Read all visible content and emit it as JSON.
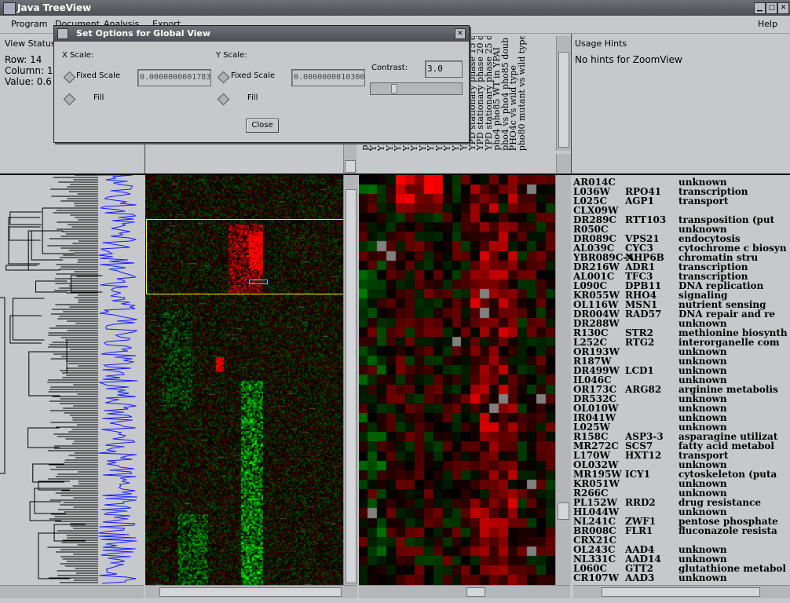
{
  "window": {
    "title": "Java TreeView",
    "buttons": {
      "minimize": "▁",
      "maximize": "□",
      "close": "✕"
    }
  },
  "menu": {
    "items": [
      "Program",
      "Document",
      "Analysis",
      "Export",
      "Help"
    ]
  },
  "status": {
    "title": "View Status",
    "row": "Row:  14",
    "column": "Column: 1",
    "value": "Value: 0.6"
  },
  "hints": {
    "title": "Usage Hints",
    "text": "No hints for ZoomView"
  },
  "dialog": {
    "title": "Set Options for Global View",
    "x_scale_label": "X Scale:",
    "y_scale_label": "Y Scale:",
    "fixed_scale": "Fixed Scale",
    "fill": "Fill",
    "x_value": "0.0000000001783",
    "y_value": "0.0000000010300",
    "contrast_label": "Contrast:",
    "contrast_value": "3.0",
    "close": "Close"
  },
  "arrays": [
    "pa",
    "YPD",
    "YPD",
    "YPD",
    "YPD",
    "YPD",
    "YPD",
    "YPD",
    "YPD",
    "YPD",
    "YPD",
    "YPD",
    "YPD stationary phase 10 d",
    "YPD stationary phase 15 d",
    "YPD stationary phase 20 d",
    "YPD stationary phase 25 d",
    "pho4 pho85 WT in YPAI",
    "pho4 vs pho4 pho85 doub",
    "PHO4c vs wild type",
    "pho80 mutant vs wild type"
  ],
  "genes": [
    {
      "id": "AR014C",
      "name": "",
      "desc": "unknown"
    },
    {
      "id": "L036W",
      "name": "RPO41",
      "desc": "transcription"
    },
    {
      "id": "L025C",
      "name": "AGP1",
      "desc": "transport"
    },
    {
      "id": "CLX09W",
      "name": "",
      "desc": ""
    },
    {
      "id": "DR289C",
      "name": "RTT103",
      "desc": "transposition (put"
    },
    {
      "id": "R050C",
      "name": "",
      "desc": "unknown"
    },
    {
      "id": "DR089C",
      "name": "VPS21",
      "desc": "endocytosis"
    },
    {
      "id": "AL039C",
      "name": "CYC3",
      "desc": "cytochrome c biosyn"
    },
    {
      "id": "YBR089C-A",
      "name": "NHP6B",
      "desc": "chromatin stru"
    },
    {
      "id": "DR216W",
      "name": "ADR1",
      "desc": "transcription"
    },
    {
      "id": "AL001C",
      "name": "TFC3",
      "desc": "transcription"
    },
    {
      "id": "L090C",
      "name": "DPB11",
      "desc": "DNA replication"
    },
    {
      "id": "KR055W",
      "name": "RHO4",
      "desc": "signaling"
    },
    {
      "id": "OL116W",
      "name": "MSN1",
      "desc": "nutrient sensing"
    },
    {
      "id": "DR004W",
      "name": "RAD57",
      "desc": "DNA repair and re"
    },
    {
      "id": "DR288W",
      "name": "",
      "desc": "unknown"
    },
    {
      "id": "R130C",
      "name": "STR2",
      "desc": "methionine biosynth"
    },
    {
      "id": "L252C",
      "name": "RTG2",
      "desc": "interorganelle com"
    },
    {
      "id": "OR193W",
      "name": "",
      "desc": "unknown"
    },
    {
      "id": "R187W",
      "name": "",
      "desc": "unknown"
    },
    {
      "id": "DR499W",
      "name": "LCD1",
      "desc": "unknown"
    },
    {
      "id": "IL046C",
      "name": "",
      "desc": "unknown"
    },
    {
      "id": "OR173C",
      "name": "ARG82",
      "desc": "arginine metabolis"
    },
    {
      "id": "DR532C",
      "name": "",
      "desc": "unknown"
    },
    {
      "id": "OL010W",
      "name": "",
      "desc": "unknown"
    },
    {
      "id": "IR041W",
      "name": "",
      "desc": "unknown"
    },
    {
      "id": "L025W",
      "name": "",
      "desc": "unknown"
    },
    {
      "id": "R158C",
      "name": "ASP3-3",
      "desc": "asparagine utilizat"
    },
    {
      "id": "MR272C",
      "name": "SCS7",
      "desc": "fatty acid metabol"
    },
    {
      "id": "L170W",
      "name": "HXT12",
      "desc": "transport"
    },
    {
      "id": "OL032W",
      "name": "",
      "desc": "unknown"
    },
    {
      "id": "MR195W",
      "name": "ICY1",
      "desc": "cytoskeleton (puta"
    },
    {
      "id": "KR051W",
      "name": "",
      "desc": "unknown"
    },
    {
      "id": "R266C",
      "name": "",
      "desc": "unknown"
    },
    {
      "id": "PL152W",
      "name": "RRD2",
      "desc": "drug resistance"
    },
    {
      "id": "HL044W",
      "name": "",
      "desc": "unknown"
    },
    {
      "id": "NL241C",
      "name": "ZWF1",
      "desc": "pentose phosphate"
    },
    {
      "id": "BR008C",
      "name": "FLR1",
      "desc": "fluconazole resista"
    },
    {
      "id": "CRX21C",
      "name": "",
      "desc": ""
    },
    {
      "id": "OL243C",
      "name": "AAD4",
      "desc": "unknown"
    },
    {
      "id": "NL331C",
      "name": "AAD14",
      "desc": "unknown"
    },
    {
      "id": "L060C",
      "name": "GTT2",
      "desc": "glutathione metabol"
    },
    {
      "id": "CR107W",
      "name": "AAD3",
      "desc": "unknown"
    }
  ],
  "colors": {
    "up": "#ff0000",
    "down": "#00ff00",
    "missing": "#808080",
    "tree": "#1a1aff",
    "selection": "#ffff00"
  }
}
